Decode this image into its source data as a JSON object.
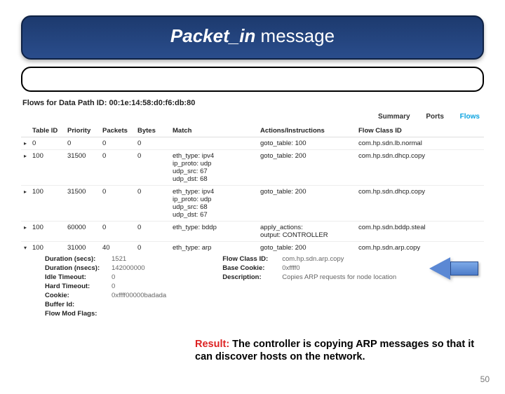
{
  "title": {
    "em": "Packet_in",
    "plain": " message"
  },
  "flows_header": "Flows for Data Path ID: 00:1e:14:58:d0:f6:db:80",
  "tabs": {
    "summary": "Summary",
    "ports": "Ports",
    "flows": "Flows"
  },
  "columns": {
    "table_id": "Table ID",
    "priority": "Priority",
    "packets": "Packets",
    "bytes": "Bytes",
    "match": "Match",
    "actions": "Actions/Instructions",
    "flow_class": "Flow Class ID"
  },
  "rows": [
    {
      "caret": "▸",
      "table_id": "0",
      "priority": "0",
      "packets": "0",
      "bytes": "0",
      "match": "",
      "actions": "goto_table: 100",
      "flow_class": "com.hp.sdn.lb.normal"
    },
    {
      "caret": "▸",
      "table_id": "100",
      "priority": "31500",
      "packets": "0",
      "bytes": "0",
      "match": "eth_type: ipv4\nip_proto: udp\nudp_src: 67\nudp_dst: 68",
      "actions": "goto_table: 200",
      "flow_class": "com.hp.sdn.dhcp.copy"
    },
    {
      "caret": "▸",
      "table_id": "100",
      "priority": "31500",
      "packets": "0",
      "bytes": "0",
      "match": "eth_type: ipv4\nip_proto: udp\nudp_src: 68\nudp_dst: 67",
      "actions": "goto_table: 200",
      "flow_class": "com.hp.sdn.dhcp.copy"
    },
    {
      "caret": "▸",
      "table_id": "100",
      "priority": "60000",
      "packets": "0",
      "bytes": "0",
      "match": "eth_type: bddp",
      "actions": "apply_actions:\noutput: CONTROLLER",
      "flow_class": "com.hp.sdn.bddp.steal"
    },
    {
      "caret": "▾",
      "table_id": "100",
      "priority": "31000",
      "packets": "40",
      "bytes": "0",
      "match": "eth_type: arp",
      "actions": "goto_table: 200",
      "flow_class": "com.hp.sdn.arp.copy"
    }
  ],
  "details": {
    "left": [
      {
        "lbl": "Duration (secs):",
        "val": "1521"
      },
      {
        "lbl": "Duration (nsecs):",
        "val": "142000000"
      },
      {
        "lbl": "Idle Timeout:",
        "val": "0"
      },
      {
        "lbl": "Hard Timeout:",
        "val": "0"
      },
      {
        "lbl": "Cookie:",
        "val": "0xffff00000badada"
      },
      {
        "lbl": "Buffer Id:",
        "val": ""
      },
      {
        "lbl": "Flow Mod Flags:",
        "val": ""
      }
    ],
    "right": [
      {
        "lbl": "Flow Class ID:",
        "val": "com.hp.sdn.arp.copy"
      },
      {
        "lbl": "Base Cookie:",
        "val": "0xffff0"
      },
      {
        "lbl": "Description:",
        "val": "Copies ARP requests for node location"
      }
    ]
  },
  "result": {
    "label": "Result:",
    "text": " The controller is copying ARP messages so that it can discover hosts on the network."
  },
  "page_number": "50"
}
